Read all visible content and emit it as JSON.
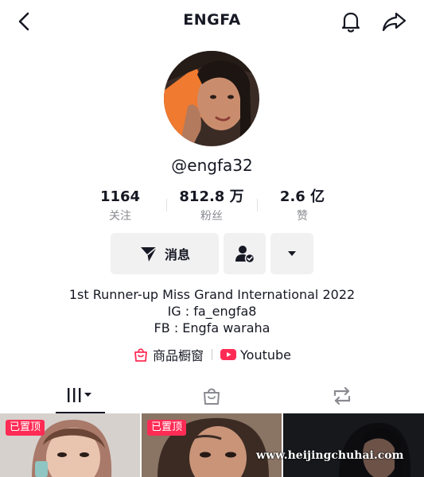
{
  "header": {
    "title": "ENGFA",
    "back_icon": "chevron-left-icon",
    "bell_icon": "bell-icon",
    "share_icon": "share-icon"
  },
  "profile": {
    "handle": "@engfa32",
    "stats": [
      {
        "value": "1164",
        "label": "关注"
      },
      {
        "value": "812.8 万",
        "label": "粉丝"
      },
      {
        "value": "2.6 亿",
        "label": "赞"
      }
    ]
  },
  "actions": {
    "message_label": "消息",
    "message_icon": "send-icon",
    "add_friend_icon": "user-check-icon",
    "more_icon": "caret-down-icon"
  },
  "bio": {
    "lines": [
      "1st Runner-up Miss Grand International 2022",
      "IG : fa_engfa8",
      "FB : Engfa waraha"
    ]
  },
  "links": {
    "shop_label": "商品橱窗",
    "youtube_label": "Youtube"
  },
  "tabs": {
    "videos_icon": "grid-icon",
    "shop_icon": "shopping-bag-icon",
    "repost_icon": "repost-icon"
  },
  "grid": {
    "pinned_label": "已置顶"
  },
  "watermark": "www.heijingchuhai.com",
  "colors": {
    "accent": "#fe2c55",
    "text": "#161823",
    "muted": "#8a8b91",
    "button_bg": "#f1f1f2"
  }
}
